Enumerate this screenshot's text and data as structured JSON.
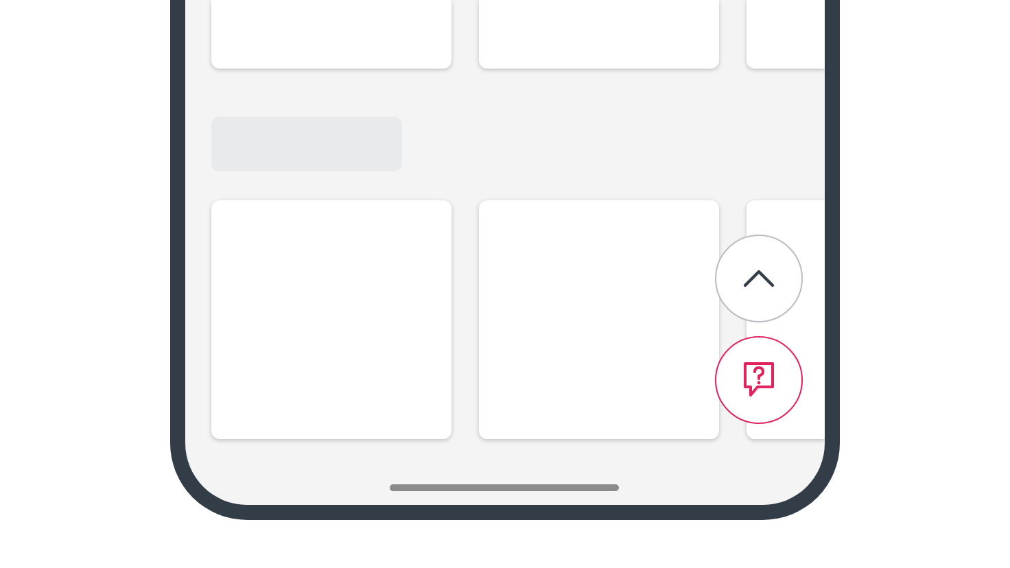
{
  "card_rows": [
    {
      "heading_placeholder": false,
      "cards": [
        {
          "kind": "card"
        },
        {
          "kind": "card"
        },
        {
          "kind": "card"
        }
      ]
    },
    {
      "heading_placeholder": true,
      "cards": [
        {
          "kind": "card"
        },
        {
          "kind": "card"
        },
        {
          "kind": "card"
        }
      ]
    }
  ],
  "floating_buttons": [
    {
      "kind": "scroll-up"
    },
    {
      "kind": "help"
    }
  ]
}
